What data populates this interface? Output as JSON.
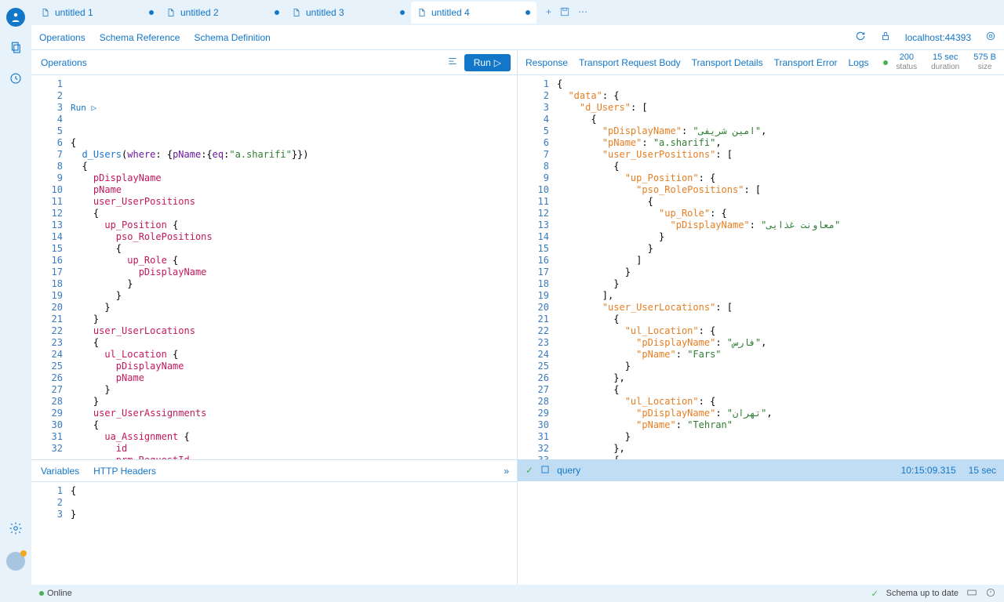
{
  "tabs": [
    {
      "label": "untitled 1",
      "modified": true
    },
    {
      "label": "untitled 2",
      "modified": true
    },
    {
      "label": "untitled 3",
      "modified": true
    },
    {
      "label": "untitled 4",
      "modified": true,
      "active": true
    }
  ],
  "secondaryTabs": {
    "operations": "Operations",
    "schemaRef": "Schema Reference",
    "schemaDef": "Schema Definition"
  },
  "endpoint": "localhost:44393",
  "opsHeader": "Operations",
  "runLabel": "Run",
  "runIndicator": "Run ▷",
  "responseHeader": {
    "response": "Response",
    "reqBody": "Transport Request Body",
    "details": "Transport Details",
    "error": "Transport Error",
    "logs": "Logs"
  },
  "stats": {
    "status": {
      "val": "200",
      "lbl": "status"
    },
    "duration": {
      "val": "15 sec",
      "lbl": "duration"
    },
    "size": {
      "val": "575 B",
      "lbl": "size"
    }
  },
  "varsTabs": {
    "variables": "Variables",
    "headers": "HTTP Headers"
  },
  "varsCode": [
    "{",
    "",
    "}"
  ],
  "logBar": {
    "label": "query",
    "time": "10:15:09.315",
    "dur": "15 sec"
  },
  "statusBar": {
    "online": "Online",
    "schema": "Schema up to date"
  },
  "queryLines": [
    [
      {
        "t": "{",
        "c": "brace"
      }
    ],
    [
      {
        "t": "  ",
        "c": ""
      },
      {
        "t": "d_Users",
        "c": "func"
      },
      {
        "t": "(",
        "c": "brace"
      },
      {
        "t": "where",
        "c": "arg"
      },
      {
        "t": ": {",
        "c": "brace"
      },
      {
        "t": "pName",
        "c": "arg"
      },
      {
        "t": ":{",
        "c": "brace"
      },
      {
        "t": "eq",
        "c": "arg"
      },
      {
        "t": ":",
        "c": "brace"
      },
      {
        "t": "\"a.sharifi\"",
        "c": "str"
      },
      {
        "t": "}})",
        "c": "brace"
      }
    ],
    [
      {
        "t": "  {",
        "c": "brace"
      }
    ],
    [
      {
        "t": "    ",
        "c": ""
      },
      {
        "t": "pDisplayName",
        "c": "key"
      }
    ],
    [
      {
        "t": "    ",
        "c": ""
      },
      {
        "t": "pName",
        "c": "key"
      }
    ],
    [
      {
        "t": "    ",
        "c": ""
      },
      {
        "t": "user_UserPositions",
        "c": "key"
      }
    ],
    [
      {
        "t": "    {",
        "c": "brace"
      }
    ],
    [
      {
        "t": "      ",
        "c": ""
      },
      {
        "t": "up_Position",
        "c": "key"
      },
      {
        "t": " {",
        "c": "brace"
      }
    ],
    [
      {
        "t": "        ",
        "c": ""
      },
      {
        "t": "pso_RolePositions",
        "c": "key"
      }
    ],
    [
      {
        "t": "        {",
        "c": "brace"
      }
    ],
    [
      {
        "t": "          ",
        "c": ""
      },
      {
        "t": "up_Role",
        "c": "key"
      },
      {
        "t": " {",
        "c": "brace"
      }
    ],
    [
      {
        "t": "            ",
        "c": ""
      },
      {
        "t": "pDisplayName",
        "c": "key"
      }
    ],
    [
      {
        "t": "          }",
        "c": "brace"
      }
    ],
    [
      {
        "t": "        }",
        "c": "brace"
      }
    ],
    [
      {
        "t": "      }",
        "c": "brace"
      }
    ],
    [
      {
        "t": "    }",
        "c": "brace"
      }
    ],
    [
      {
        "t": "    ",
        "c": ""
      },
      {
        "t": "user_UserLocations",
        "c": "key"
      }
    ],
    [
      {
        "t": "    {",
        "c": "brace"
      }
    ],
    [
      {
        "t": "      ",
        "c": ""
      },
      {
        "t": "ul_Location",
        "c": "key"
      },
      {
        "t": " {",
        "c": "brace"
      }
    ],
    [
      {
        "t": "        ",
        "c": ""
      },
      {
        "t": "pDisplayName",
        "c": "key"
      }
    ],
    [
      {
        "t": "        ",
        "c": ""
      },
      {
        "t": "pName",
        "c": "key"
      }
    ],
    [
      {
        "t": "      }",
        "c": "brace"
      }
    ],
    [
      {
        "t": "    }",
        "c": "brace"
      }
    ],
    [
      {
        "t": "    ",
        "c": ""
      },
      {
        "t": "user_UserAssignments",
        "c": "key"
      }
    ],
    [
      {
        "t": "    {",
        "c": "brace"
      }
    ],
    [
      {
        "t": "      ",
        "c": ""
      },
      {
        "t": "ua_Assignment",
        "c": "key"
      },
      {
        "t": " {",
        "c": "brace"
      }
    ],
    [
      {
        "t": "        ",
        "c": ""
      },
      {
        "t": "id",
        "c": "key"
      }
    ],
    [
      {
        "t": "        ",
        "c": ""
      },
      {
        "t": "prm_RequestId",
        "c": "key"
      }
    ],
    [
      {
        "t": "      }",
        "c": "brace"
      }
    ],
    [
      {
        "t": "    }",
        "c": "brace"
      }
    ],
    [
      {
        "t": "  }",
        "c": "brace"
      }
    ],
    [
      {
        "t": "}",
        "c": "brace"
      }
    ]
  ],
  "responseLines": [
    [
      {
        "t": "{",
        "c": "punc"
      }
    ],
    [
      {
        "t": "  ",
        "c": ""
      },
      {
        "t": "\"data\"",
        "c": "key"
      },
      {
        "t": ": {",
        "c": "punc"
      }
    ],
    [
      {
        "t": "    ",
        "c": ""
      },
      {
        "t": "\"d_Users\"",
        "c": "key"
      },
      {
        "t": ": [",
        "c": "punc"
      }
    ],
    [
      {
        "t": "      {",
        "c": "punc"
      }
    ],
    [
      {
        "t": "        ",
        "c": ""
      },
      {
        "t": "\"pDisplayName\"",
        "c": "key"
      },
      {
        "t": ": ",
        "c": "punc"
      },
      {
        "t": "\"امین شریفی\"",
        "c": "str"
      },
      {
        "t": ",",
        "c": "punc"
      }
    ],
    [
      {
        "t": "        ",
        "c": ""
      },
      {
        "t": "\"pName\"",
        "c": "key"
      },
      {
        "t": ": ",
        "c": "punc"
      },
      {
        "t": "\"a.sharifi\"",
        "c": "str"
      },
      {
        "t": ",",
        "c": "punc"
      }
    ],
    [
      {
        "t": "        ",
        "c": ""
      },
      {
        "t": "\"user_UserPositions\"",
        "c": "key"
      },
      {
        "t": ": [",
        "c": "punc"
      }
    ],
    [
      {
        "t": "          {",
        "c": "punc"
      }
    ],
    [
      {
        "t": "            ",
        "c": ""
      },
      {
        "t": "\"up_Position\"",
        "c": "key"
      },
      {
        "t": ": {",
        "c": "punc"
      }
    ],
    [
      {
        "t": "              ",
        "c": ""
      },
      {
        "t": "\"pso_RolePositions\"",
        "c": "key"
      },
      {
        "t": ": [",
        "c": "punc"
      }
    ],
    [
      {
        "t": "                {",
        "c": "punc"
      }
    ],
    [
      {
        "t": "                  ",
        "c": ""
      },
      {
        "t": "\"up_Role\"",
        "c": "key"
      },
      {
        "t": ": {",
        "c": "punc"
      }
    ],
    [
      {
        "t": "                    ",
        "c": ""
      },
      {
        "t": "\"pDisplayName\"",
        "c": "key"
      },
      {
        "t": ": ",
        "c": "punc"
      },
      {
        "t": "\"معاونت غذایی\"",
        "c": "str"
      }
    ],
    [
      {
        "t": "                  }",
        "c": "punc"
      }
    ],
    [
      {
        "t": "                }",
        "c": "punc"
      }
    ],
    [
      {
        "t": "              ]",
        "c": "punc"
      }
    ],
    [
      {
        "t": "            }",
        "c": "punc"
      }
    ],
    [
      {
        "t": "          }",
        "c": "punc"
      }
    ],
    [
      {
        "t": "        ],",
        "c": "punc"
      }
    ],
    [
      {
        "t": "        ",
        "c": ""
      },
      {
        "t": "\"user_UserLocations\"",
        "c": "key"
      },
      {
        "t": ": [",
        "c": "punc"
      }
    ],
    [
      {
        "t": "          {",
        "c": "punc"
      }
    ],
    [
      {
        "t": "            ",
        "c": ""
      },
      {
        "t": "\"ul_Location\"",
        "c": "key"
      },
      {
        "t": ": {",
        "c": "punc"
      }
    ],
    [
      {
        "t": "              ",
        "c": ""
      },
      {
        "t": "\"pDisplayName\"",
        "c": "key"
      },
      {
        "t": ": ",
        "c": "punc"
      },
      {
        "t": "\"فارس\"",
        "c": "str"
      },
      {
        "t": ",",
        "c": "punc"
      }
    ],
    [
      {
        "t": "              ",
        "c": ""
      },
      {
        "t": "\"pName\"",
        "c": "key"
      },
      {
        "t": ": ",
        "c": "punc"
      },
      {
        "t": "\"Fars\"",
        "c": "str"
      }
    ],
    [
      {
        "t": "            }",
        "c": "punc"
      }
    ],
    [
      {
        "t": "          },",
        "c": "punc"
      }
    ],
    [
      {
        "t": "          {",
        "c": "punc"
      }
    ],
    [
      {
        "t": "            ",
        "c": ""
      },
      {
        "t": "\"ul_Location\"",
        "c": "key"
      },
      {
        "t": ": {",
        "c": "punc"
      }
    ],
    [
      {
        "t": "              ",
        "c": ""
      },
      {
        "t": "\"pDisplayName\"",
        "c": "key"
      },
      {
        "t": ": ",
        "c": "punc"
      },
      {
        "t": "\"تهران\"",
        "c": "str"
      },
      {
        "t": ",",
        "c": "punc"
      }
    ],
    [
      {
        "t": "              ",
        "c": ""
      },
      {
        "t": "\"pName\"",
        "c": "key"
      },
      {
        "t": ": ",
        "c": "punc"
      },
      {
        "t": "\"Tehran\"",
        "c": "str"
      }
    ],
    [
      {
        "t": "            }",
        "c": "punc"
      }
    ],
    [
      {
        "t": "          },",
        "c": "punc"
      }
    ],
    [
      {
        "t": "          {",
        "c": "punc"
      }
    ]
  ]
}
